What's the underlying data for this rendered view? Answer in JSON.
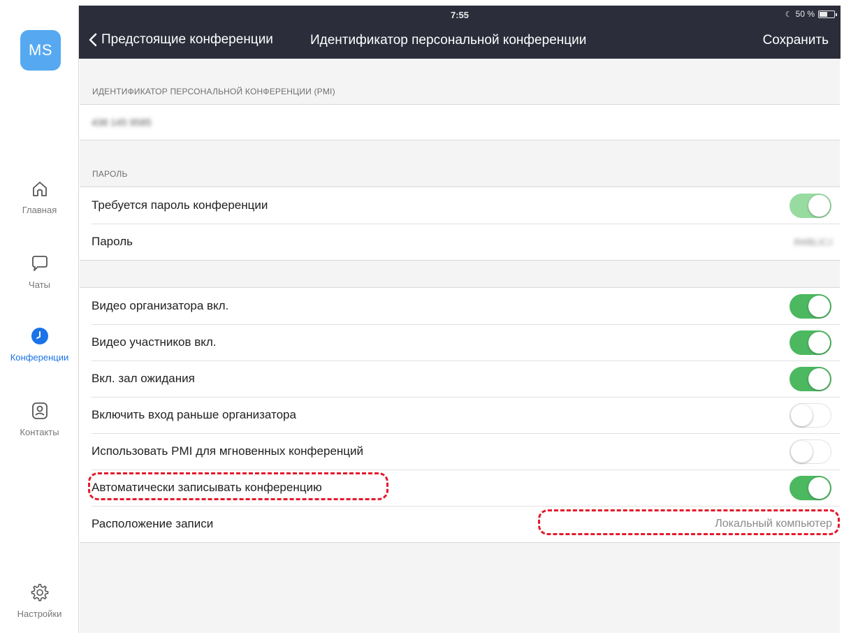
{
  "status": {
    "time": "7:55",
    "battery": "50 %"
  },
  "nav": {
    "back_label": "Предстоящие конференции",
    "title": "Идентификатор персональной конференции",
    "save_label": "Сохранить"
  },
  "sidebar": {
    "avatar": "MS",
    "items": [
      {
        "label": "Главная",
        "icon": "home-icon"
      },
      {
        "label": "Чаты",
        "icon": "chat-icon"
      },
      {
        "label": "Конференции",
        "icon": "clock-icon",
        "active": true
      },
      {
        "label": "Контакты",
        "icon": "contacts-icon"
      },
      {
        "label": "Настройки",
        "icon": "gear-icon"
      }
    ]
  },
  "pmi": {
    "header": "ИДЕНТИФИКАТОР ПЕРСОНАЛЬНОЙ КОНФЕРЕНЦИИ (PMI)",
    "value": "438 145 9585"
  },
  "password": {
    "header": "ПАРОЛЬ",
    "require_label": "Требуется пароль конференции",
    "require_on": true,
    "password_label": "Пароль",
    "password_value": "8WBLICJ"
  },
  "options": [
    {
      "label": "Видео организатора вкл.",
      "on": true
    },
    {
      "label": "Видео участников вкл.",
      "on": true
    },
    {
      "label": "Вкл. зал ожидания",
      "on": true
    },
    {
      "label": "Включить вход раньше организатора",
      "on": false
    },
    {
      "label": "Использовать PMI для мгновенных конференций",
      "on": false
    },
    {
      "label": "Автоматически записывать конференцию",
      "on": true
    },
    {
      "label": "Расположение записи",
      "value": "Локальный компьютер"
    }
  ],
  "colors": {
    "accent": "#1a73e8",
    "toggle_on": "#4cb860",
    "topbar": "#2b2d3a",
    "highlight": "#e4192b"
  }
}
